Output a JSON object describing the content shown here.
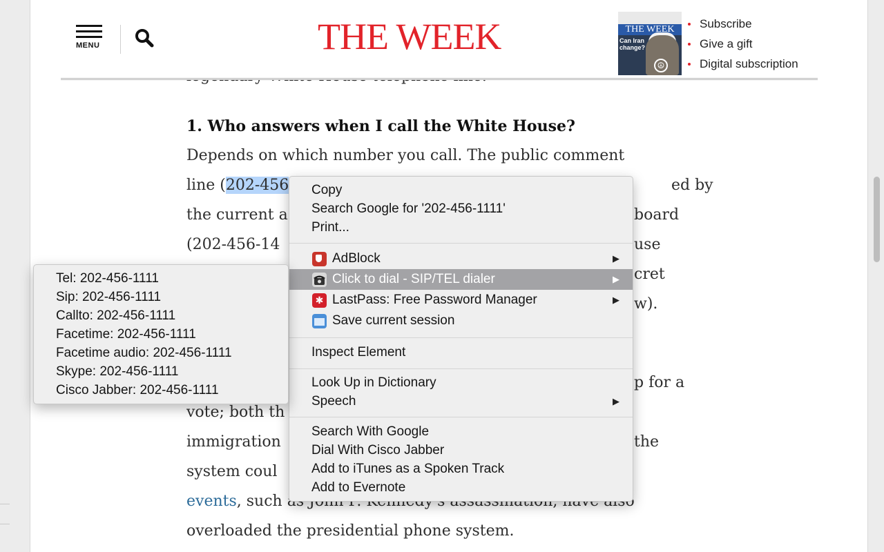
{
  "header": {
    "menu_label": "MENU",
    "logo": "THE WEEK",
    "cover": {
      "masthead": "THE WEEK",
      "headline": "Can Iran change?"
    },
    "links": [
      "Subscribe",
      "Give a gift",
      "Digital subscription"
    ]
  },
  "article": {
    "partial_line": "legendary White House telephone line.",
    "heading": "1. Who answers when I call the White House?",
    "line1": "Depends on which number you call. The public comment",
    "line2_pre": "line (",
    "line2_sel": "202-456",
    "line2_post": "ed by",
    "line3_pre": "the current a",
    "line3_post": "board",
    "line4_pre": "(202-456-14",
    "line4_post": "use",
    "line5_post": "cret",
    "line6_post": "w).",
    "line7_post": "p for a",
    "line8_pre": "vote; both th",
    "line9_pre": "immigration",
    "line9_post": "the",
    "line10_pre": "system coul",
    "line11_link": "events",
    "line11_rest": ", such as John F. Kennedy's assassination, have also",
    "line12": "overloaded the presidential phone system."
  },
  "context_menu": {
    "copy": "Copy",
    "search_google": "Search Google for '202-456-1111'",
    "print": "Print...",
    "adblock": "AdBlock",
    "click_to_dial": "Click to dial - SIP/TEL dialer",
    "lastpass": "LastPass: Free Password Manager",
    "save_session": "Save current session",
    "inspect": "Inspect Element",
    "look_up": "Look Up in Dictionary",
    "speech": "Speech",
    "search_with_google": "Search With Google",
    "dial_cisco": "Dial With Cisco Jabber",
    "add_itunes": "Add to iTunes as a Spoken Track",
    "add_evernote": "Add to Evernote"
  },
  "submenu": {
    "items": [
      "Tel: 202-456-1111",
      "Sip: 202-456-1111",
      "Callto: 202-456-1111",
      "Facetime: 202-456-1111",
      "Facetime audio: 202-456-1111",
      "Skype: 202-456-1111",
      "Cisco Jabber: 202-456-1111"
    ]
  },
  "colors": {
    "logo_red": "#e2232a",
    "selection": "#b5d5fb",
    "menu_highlight": "#a3a3a6",
    "link": "#2c6b99"
  }
}
